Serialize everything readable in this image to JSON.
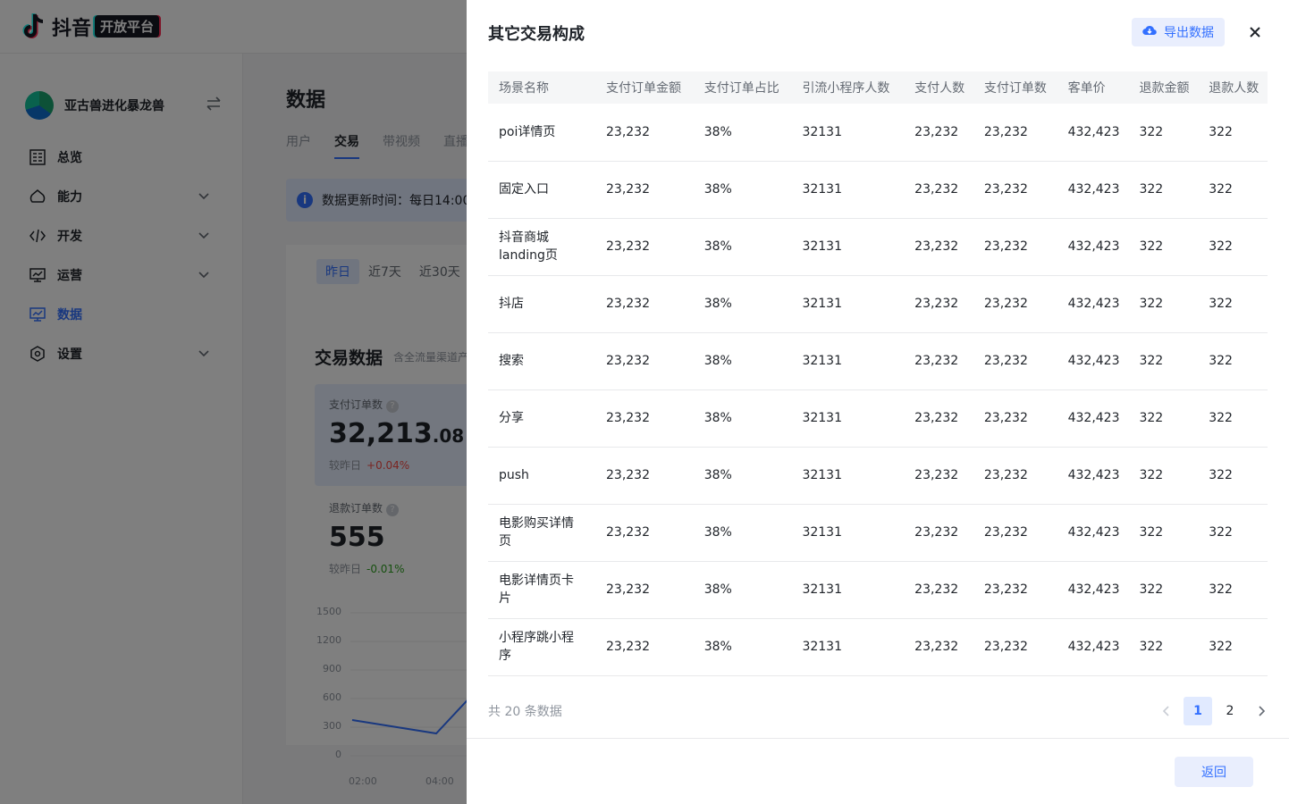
{
  "brand": {
    "logo_text": "抖音",
    "badge": "开放平台"
  },
  "app": {
    "name": "亚古兽进化暴龙兽"
  },
  "sidebar": {
    "items": [
      {
        "label": "总览",
        "icon": "dashboard-icon"
      },
      {
        "label": "能力",
        "icon": "capability-icon"
      },
      {
        "label": "开发",
        "icon": "code-icon"
      },
      {
        "label": "运营",
        "icon": "operation-icon"
      },
      {
        "label": "数据",
        "icon": "data-icon",
        "active": true
      },
      {
        "label": "设置",
        "icon": "settings-icon"
      }
    ]
  },
  "main": {
    "title": "数据",
    "tabs": [
      "用户",
      "交易",
      "带视频",
      "直播"
    ],
    "notice": "数据更新时间：每日14:00",
    "date_tabs": [
      "昨日",
      "近7天",
      "近30天"
    ],
    "section_title": "交易数据",
    "section_sub": "含全流量渠道产",
    "stats": [
      {
        "label": "支付订单数",
        "value_main": "32,213",
        "value_dec": ".08",
        "cmp_label": "较昨日",
        "cmp": "+0.04%"
      },
      {
        "label": "退款订单数",
        "value_main": "555",
        "value_dec": "",
        "cmp_label": "较昨日",
        "cmp": "-0.01%"
      }
    ],
    "chart": {
      "y_ticks": [
        "1500",
        "1200",
        "900",
        "600",
        "300",
        "0"
      ],
      "x_ticks": [
        "02:00",
        "04:00"
      ]
    }
  },
  "drawer": {
    "title": "其它交易构成",
    "export_label": "导出数据",
    "columns": [
      "场景名称",
      "支付订单金额",
      "支付订单占比",
      "引流小程序人数",
      "支付人数",
      "支付订单数",
      "客单价",
      "退款金额",
      "退款人数"
    ],
    "rows": [
      [
        "poi详情页",
        "23,232",
        "38%",
        "32131",
        "23,232",
        "23,232",
        "432,423",
        "322",
        "322"
      ],
      [
        "固定入口",
        "23,232",
        "38%",
        "32131",
        "23,232",
        "23,232",
        "432,423",
        "322",
        "322"
      ],
      [
        "抖音商城landing页",
        "23,232",
        "38%",
        "32131",
        "23,232",
        "23,232",
        "432,423",
        "322",
        "322"
      ],
      [
        "抖店",
        "23,232",
        "38%",
        "32131",
        "23,232",
        "23,232",
        "432,423",
        "322",
        "322"
      ],
      [
        "搜索",
        "23,232",
        "38%",
        "32131",
        "23,232",
        "23,232",
        "432,423",
        "322",
        "322"
      ],
      [
        "分享",
        "23,232",
        "38%",
        "32131",
        "23,232",
        "23,232",
        "432,423",
        "322",
        "322"
      ],
      [
        "push",
        "23,232",
        "38%",
        "32131",
        "23,232",
        "23,232",
        "432,423",
        "322",
        "322"
      ],
      [
        "电影购买详情页",
        "23,232",
        "38%",
        "32131",
        "23,232",
        "23,232",
        "432,423",
        "322",
        "322"
      ],
      [
        "电影详情页卡片",
        "23,232",
        "38%",
        "32131",
        "23,232",
        "23,232",
        "432,423",
        "322",
        "322"
      ],
      [
        "小程序跳小程序",
        "23,232",
        "38%",
        "32131",
        "23,232",
        "23,232",
        "432,423",
        "322",
        "322"
      ]
    ],
    "total_text": "共 20 条数据",
    "pages": [
      "1",
      "2"
    ],
    "current_page": "1",
    "back_label": "返回"
  },
  "colors": {
    "accent": "#3370ff",
    "accent_bg": "#e9eefd",
    "overlay": "rgba(0,0,0,0.5)"
  }
}
